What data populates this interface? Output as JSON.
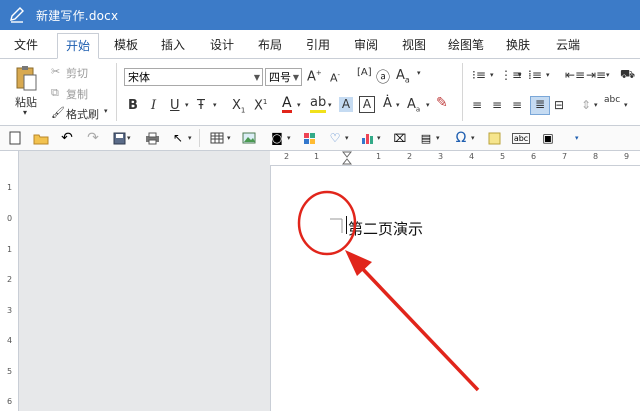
{
  "title": {
    "filename": "新建写作.docx"
  },
  "menu": {
    "tabs": [
      "文件",
      "开始",
      "模板",
      "插入",
      "设计",
      "布局",
      "引用",
      "审阅",
      "视图",
      "绘图笔",
      "换肤",
      "云端"
    ],
    "active": "开始"
  },
  "ribbon": {
    "clipboard": {
      "paste": "粘贴",
      "cut": "剪切",
      "copy": "复制",
      "format_painter": "格式刷"
    },
    "font": {
      "family": "宋体",
      "size": "四号"
    }
  },
  "rulers": {
    "horizontal": [
      "2",
      "1",
      "1",
      "2",
      "3",
      "4",
      "5",
      "6",
      "7",
      "8",
      "9"
    ],
    "vertical": [
      "1",
      "0",
      "1",
      "2",
      "3",
      "4",
      "5",
      "6"
    ]
  },
  "document": {
    "text": "第二页演示"
  },
  "colors": {
    "titlebar": "#3c7bc8",
    "annotation": "#e1251b",
    "active_tab_text": "#1e5eb0"
  }
}
